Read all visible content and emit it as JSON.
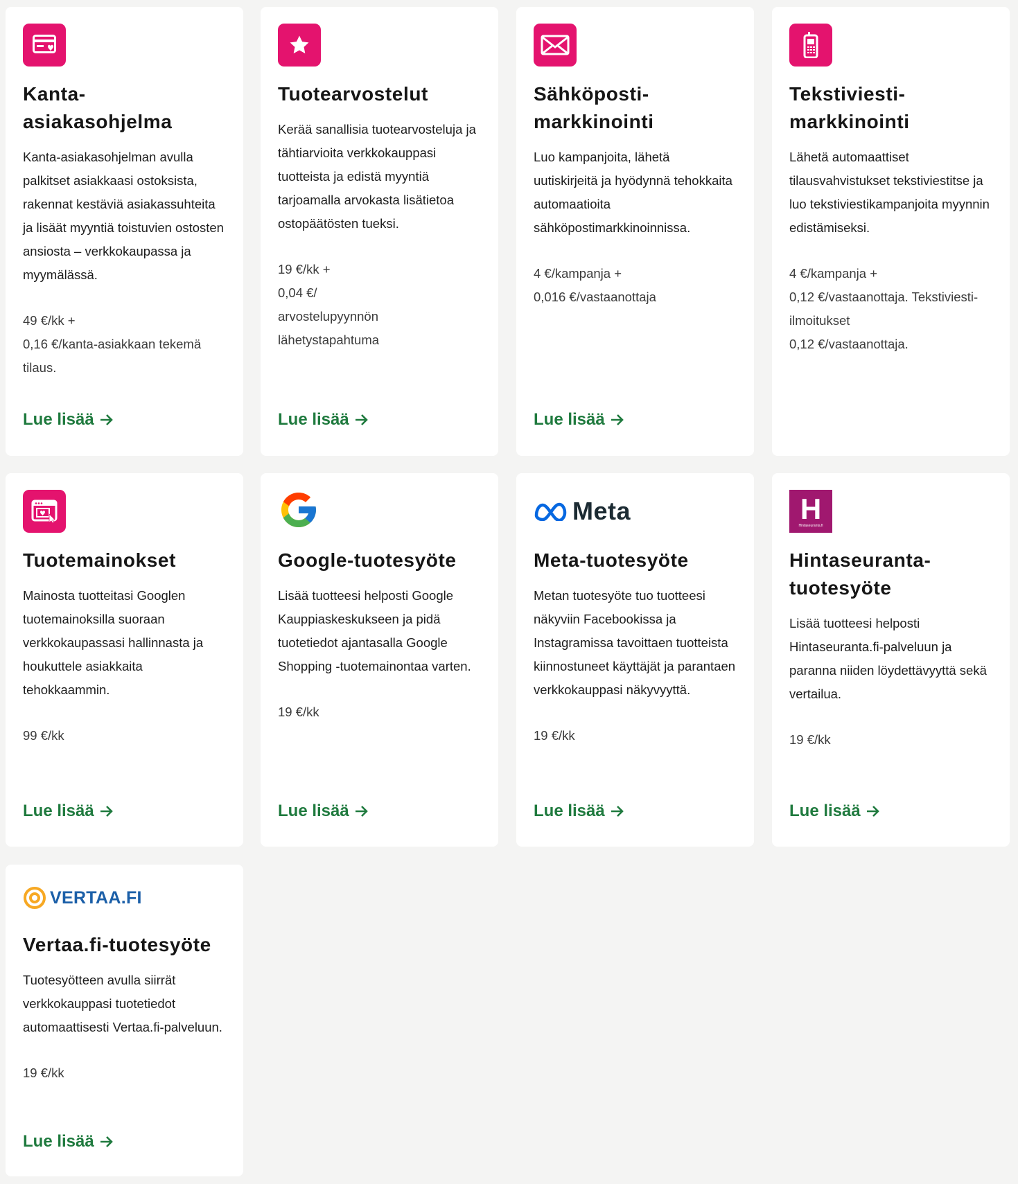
{
  "colors": {
    "accent": "#e4136e",
    "link": "#1f7a3e",
    "background": "#f4f4f3"
  },
  "cards": [
    {
      "icon": "loyalty-card-icon",
      "title": "Kanta-\nasiakasohjelma",
      "description": "Kanta-asiakasohjelman avulla palkitset asiakkaasi ostoksista, rakennat kestäviä asiakassuhteita ja lisäät myyntiä toistuvien ostosten ansiosta – verkkokaupassa ja myymälässä.",
      "price": "49 €/kk +\n0,16 €/kanta-asiakkaan tekemä tilaus.",
      "link": "Lue lisää"
    },
    {
      "icon": "star-icon",
      "title": "Tuotearvostelut",
      "description": "Kerää sanallisia tuotearvosteluja ja tähtiarvioita verkkokauppasi tuotteista ja edistä myyntiä tarjoamalla arvokasta lisätietoa ostopäätösten tueksi.",
      "price": "19 €/kk +\n0,04 €/\narvostelupyynnön\nlähetystapahtuma",
      "link": "Lue lisää"
    },
    {
      "icon": "envelope-icon",
      "title": "Sähköposti-\nmarkkinointi",
      "description": "Luo kampanjoita, lähetä uutiskirjeitä ja hyödynnä tehokkaita automaatioita sähköpostimarkkinoinnissa.",
      "price": "4 €/kampanja +\n0,016 €/vastaanottaja",
      "link": "Lue lisää"
    },
    {
      "icon": "mobile-phone-icon",
      "title": "Tekstiviesti-\nmarkkinointi",
      "description": "Lähetä automaattiset tilausvahvistukset tekstiviestitse ja luo tekstiviestikampanjoita myynnin edistämiseksi.",
      "price": "4 €/kampanja +\n0,12 €/vastaanottaja. Tekstiviesti-\nilmoitukset\n0,12 €/vastaanottaja.",
      "link": ""
    },
    {
      "icon": "product-ad-icon",
      "title": "Tuotemainokset",
      "description": "Mainosta tuotteitasi Googlen tuotemainoksilla suoraan verkkokaupassasi hallinnasta ja houkuttele asiakkaita tehokkaammin.",
      "price": "99 €/kk",
      "link": "Lue lisää"
    },
    {
      "icon": "google-logo-icon",
      "title": "Google-tuotesyöte",
      "description": "Lisää tuotteesi helposti Google Kauppiaskeskukseen ja pidä tuotetiedot ajantasalla Google Shopping -tuotemainontaa varten.",
      "price": "19 €/kk",
      "link": "Lue lisää"
    },
    {
      "icon": "meta-logo-icon",
      "logo_text": "Meta",
      "title": "Meta-tuotesyöte",
      "description": "Metan tuotesyöte tuo tuotteesi näkyviin Facebookissa ja Instagramissa tavoittaen tuotteista kiinnostuneet käyttäjät ja parantaen verkkokauppasi näkyvyyttä.",
      "price": "19 €/kk",
      "link": "Lue lisää"
    },
    {
      "icon": "hintaseuranta-logo-icon",
      "logo_text": "H",
      "logo_subtext": "Hintaseuranta.fi",
      "title": "Hintaseuranta-\ntuotesyöte",
      "description": "Lisää tuotteesi helposti Hintaseuranta.fi-palveluun ja paranna niiden löydettävyyttä sekä vertailua.",
      "price": "19 €/kk",
      "link": "Lue lisää"
    },
    {
      "icon": "vertaa-logo-icon",
      "logo_text": "VERTAA.FI",
      "title": "Vertaa.fi-tuotesyöte",
      "description": "Tuotesyötteen avulla siirrät verkkokauppasi tuotetiedot automaattisesti Vertaa.fi-palveluun.",
      "price": "19 €/kk",
      "link": "Lue lisää"
    }
  ]
}
